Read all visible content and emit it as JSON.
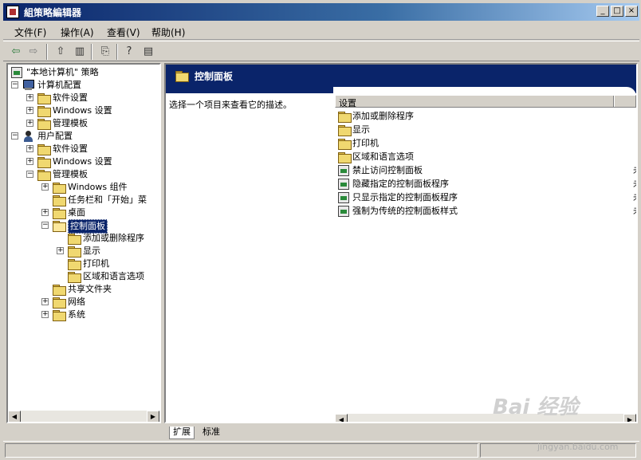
{
  "window": {
    "title": "組策略編辑器",
    "min_glyph": "_",
    "max_glyph": "□",
    "close_glyph": "×"
  },
  "menu": [
    {
      "label": "文件(F)"
    },
    {
      "label": "操作(A)"
    },
    {
      "label": "查看(V)"
    },
    {
      "label": "帮助(H)"
    }
  ],
  "toolbar": {
    "back_glyph": "⇦",
    "forward_glyph": "⇨",
    "up_glyph": "⇧",
    "panel_glyph": "▥",
    "export_glyph": "⎘",
    "help_glyph": "?",
    "view_glyph": "▤"
  },
  "tree": [
    {
      "label": "\"本地计算机\" 策略",
      "level": 0,
      "expander": "",
      "icon": "policy"
    },
    {
      "label": "计算机配置",
      "level": 1,
      "expander": "−",
      "icon": "pc"
    },
    {
      "label": "软件设置",
      "level": 2,
      "expander": "+",
      "icon": "folder"
    },
    {
      "label": "Windows 设置",
      "level": 2,
      "expander": "+",
      "icon": "folder"
    },
    {
      "label": "管理模板",
      "level": 2,
      "expander": "+",
      "icon": "folder"
    },
    {
      "label": "用户配置",
      "level": 1,
      "expander": "−",
      "icon": "user"
    },
    {
      "label": "软件设置",
      "level": 2,
      "expander": "+",
      "icon": "folder"
    },
    {
      "label": "Windows 设置",
      "level": 2,
      "expander": "+",
      "icon": "folder"
    },
    {
      "label": "管理模板",
      "level": 2,
      "expander": "−",
      "icon": "folder"
    },
    {
      "label": "Windows 组件",
      "level": 3,
      "expander": "+",
      "icon": "folder"
    },
    {
      "label": "任务栏和「开始」菜",
      "level": 3,
      "expander": "",
      "icon": "folder"
    },
    {
      "label": "桌面",
      "level": 3,
      "expander": "+",
      "icon": "folder"
    },
    {
      "label": "控制面板",
      "level": 3,
      "expander": "−",
      "icon": "folder-open",
      "selected": true
    },
    {
      "label": "添加或删除程序",
      "level": 4,
      "expander": "",
      "icon": "folder"
    },
    {
      "label": "显示",
      "level": 4,
      "expander": "+",
      "icon": "folder"
    },
    {
      "label": "打印机",
      "level": 4,
      "expander": "",
      "icon": "folder"
    },
    {
      "label": "区域和语言选项",
      "level": 4,
      "expander": "",
      "icon": "folder"
    },
    {
      "label": "共享文件夹",
      "level": 3,
      "expander": "",
      "icon": "folder"
    },
    {
      "label": "网络",
      "level": 3,
      "expander": "+",
      "icon": "folder"
    },
    {
      "label": "系统",
      "level": 3,
      "expander": "+",
      "icon": "folder"
    }
  ],
  "right_pane": {
    "header_title": "控制面板",
    "description": "选择一个项目来查看它的描述。",
    "column_header": "设置",
    "items": [
      {
        "label": "添加或删除程序",
        "icon": "folder",
        "tail": ""
      },
      {
        "label": "显示",
        "icon": "folder",
        "tail": ""
      },
      {
        "label": "打印机",
        "icon": "folder",
        "tail": ""
      },
      {
        "label": "区域和语言选项",
        "icon": "folder",
        "tail": ""
      },
      {
        "label": "禁止访问控制面板",
        "icon": "policy",
        "tail": "未"
      },
      {
        "label": "隐藏指定的控制面板程序",
        "icon": "policy",
        "tail": "未"
      },
      {
        "label": "只显示指定的控制面板程序",
        "icon": "policy",
        "tail": "未"
      },
      {
        "label": "强制为传统的控制面板样式",
        "icon": "policy",
        "tail": "未"
      }
    ]
  },
  "tabs": [
    {
      "label": "扩展"
    },
    {
      "label": "标准"
    }
  ],
  "scroll": {
    "left_glyph": "◀",
    "right_glyph": "▶"
  },
  "watermark": {
    "logo": "Bai 经验",
    "url": "jingyan.baidu.com"
  }
}
